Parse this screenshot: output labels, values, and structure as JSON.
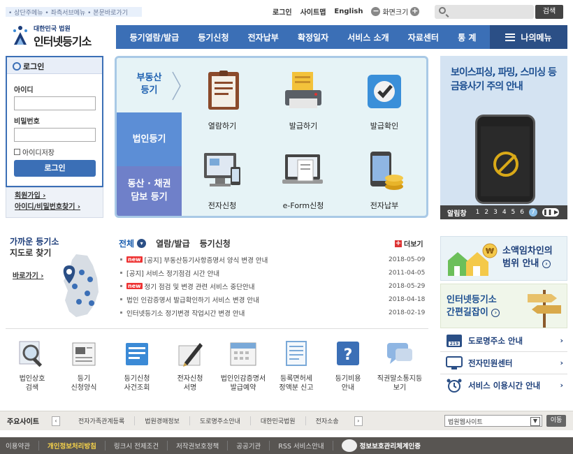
{
  "topbar": {
    "skip_links": "• 상단주메뉴 • 좌측서브메뉴 • 본문바로가기",
    "util_login": "로그인",
    "util_sitemap": "사이트맵",
    "util_english": "English",
    "font_minus": "−",
    "font_label": "화면크기",
    "font_plus": "+",
    "search_button": "검색"
  },
  "logo": {
    "line1": "대한민국 법원",
    "line2": "인터넷등기소"
  },
  "gnb": {
    "items": [
      "등기열람/발급",
      "등기신청",
      "전자납부",
      "확정일자",
      "서비스 소개",
      "자료센터",
      "통 계"
    ],
    "my_menu": "나의메뉴"
  },
  "login": {
    "title": "로그인",
    "id_label": "아이디",
    "pw_label": "비밀번호",
    "save_id": "아이디저장",
    "button": "로그인",
    "join": "회원가입 ›",
    "find": "아이디/비밀번호찾기 ›"
  },
  "services": {
    "cat_realestate_1": "부동산",
    "cat_realestate_2": "등기",
    "cat_corp": "법인등기",
    "cat_movable_1": "동산 · 채권",
    "cat_movable_2": "담보 등기",
    "items": [
      "열람하기",
      "발급하기",
      "발급확인",
      "전자신청",
      "e-Form신청",
      "전자납부"
    ]
  },
  "ad": {
    "title": "보이스피싱, 파밍, 스미싱 등 금융사기 주의 안내",
    "bar_label": "알림창",
    "pages": [
      "1",
      "2",
      "3",
      "4",
      "5",
      "6",
      "7"
    ],
    "pause": "❚❚ ▶"
  },
  "map": {
    "title1": "가까운 등기소",
    "title2": "지도로 찾기",
    "go": "바로가기 ›"
  },
  "notice": {
    "tabs": [
      "전체",
      "열람/발급",
      "등기신청"
    ],
    "more": "더보기",
    "new_badge": "new",
    "items": [
      {
        "text": "[공지] 부동산등기사항증명서 양식 변경 안내",
        "date": "2018-05-09"
      },
      {
        "text": "[공지] 서비스 정기점검 시간 안내",
        "date": "2011-04-05"
      },
      {
        "text": "정기 점검 및 변경 관련 서비스 중단안내",
        "date": "2018-05-29"
      },
      {
        "text": "법인 인감증명서 발급확인하기 서비스 변경 안내",
        "date": "2018-04-18"
      },
      {
        "text": "인터넷등기소 정기변경 작업시간 변경 안내",
        "date": "2018-02-19"
      }
    ]
  },
  "quick": [
    {
      "l1": "법인상호",
      "l2": "검색"
    },
    {
      "l1": "등기",
      "l2": "신청양식"
    },
    {
      "l1": "등기신청",
      "l2": "사건조회"
    },
    {
      "l1": "전자신청",
      "l2": "서명"
    },
    {
      "l1": "법인인감증명서",
      "l2": "발급예약"
    },
    {
      "l1": "등록면허세",
      "l2": "정액분 신고"
    },
    {
      "l1": "등기비용",
      "l2": "안내"
    },
    {
      "l1": "직권말소통지등",
      "l2": "보기"
    }
  ],
  "banners": {
    "lease_1": "소액임차인의",
    "lease_2": "범위 안내",
    "guide_1": "인터넷등기소",
    "guide_2": "간편길잡이",
    "links": [
      "도로명주소 안내",
      "전자민원센터",
      "서비스 이용시간 안내"
    ]
  },
  "sites": {
    "title": "주요사이트",
    "prev": "‹",
    "next": "›",
    "items": [
      "전자가족관계등록",
      "법원경매정보",
      "도로명주소안내",
      "대한민국법원",
      "전자소송"
    ],
    "select": "법원웹사이트",
    "go": "이동"
  },
  "footer": {
    "items": [
      "이용약관",
      "개인정보처리방침",
      "링크시 전제조건",
      "저작권보호정책",
      "공공기관",
      "RSS 서비스안내"
    ],
    "cert": "정보보호관리체계인증"
  },
  "colors": {
    "primary": "#3b6fb6",
    "dark": "#2b4f86",
    "footer": "#585552"
  }
}
